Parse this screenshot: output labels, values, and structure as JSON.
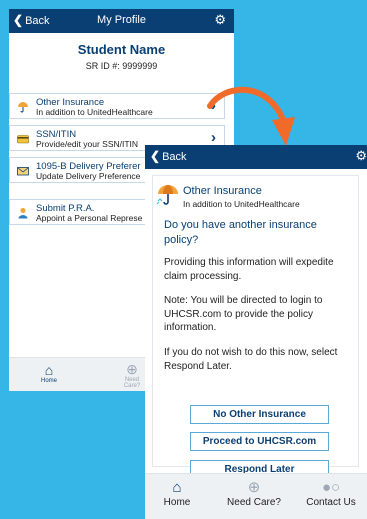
{
  "colors": {
    "background": "#35b6e6",
    "navbar": "#0a3f73",
    "accent": "#f06a2a",
    "button_border": "#5aa9d8"
  },
  "screen_back": {
    "nav": {
      "back_label": "Back",
      "title": "My Profile",
      "settings_icon": "gear-icon"
    },
    "student": {
      "name": "Student Name",
      "sr_id": "SR ID #: 9999999"
    },
    "menu": [
      {
        "icon": "umbrella-icon",
        "title": "Other Insurance",
        "subtitle": "In addition to UnitedHealthcare"
      },
      {
        "icon": "card-icon",
        "title": "SSN/ITIN",
        "subtitle": "Provide/edit your SSN/ITIN"
      },
      {
        "icon": "envelope-icon",
        "title": "1095-B Delivery Preferer",
        "subtitle": "Update Delivery Preference"
      },
      {
        "icon": "person-icon",
        "title": "Submit P.R.A.",
        "subtitle": "Appoint a Personal Represe"
      }
    ],
    "tabs": {
      "home": "Home",
      "need_care": "Need Care?"
    }
  },
  "screen_front": {
    "nav": {
      "back_label": "Back",
      "settings_icon": "gear-icon"
    },
    "card": {
      "title": "Other Insurance",
      "subtitle": "In addition to UnitedHealthcare",
      "question": "Do you have another insurance policy?",
      "para1": "Providing this information will expedite claim processing.",
      "para2": "Note: You will be directed to login to UHCSR.com to provide the policy information.",
      "para3": "If you do not wish to do this now, select Respond Later.",
      "buttons": {
        "no_other": "No Other Insurance",
        "proceed": "Proceed to UHCSR.com",
        "later": "Respond Later"
      }
    },
    "tabs": {
      "home": "Home",
      "need_care": "Need Care?",
      "contact": "Contact Us"
    }
  }
}
